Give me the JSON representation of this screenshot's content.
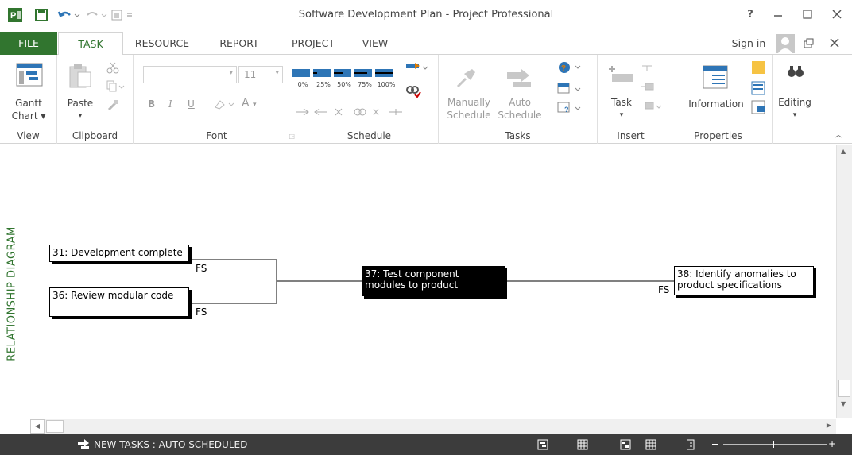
{
  "window": {
    "title": "Software Development Plan - Project Professional",
    "help": "?",
    "sign_in": "Sign in"
  },
  "tabs": [
    "FILE",
    "TASK",
    "RESOURCE",
    "REPORT",
    "PROJECT",
    "VIEW"
  ],
  "ribbon": {
    "view_group": {
      "gantt_line1": "Gantt",
      "gantt_line2": "Chart",
      "label": "View"
    },
    "clipboard_group": {
      "paste": "Paste",
      "label": "Clipboard"
    },
    "font_group": {
      "font_size": "11",
      "bold": "B",
      "italic": "I",
      "underline": "U",
      "font_color": "A",
      "label": "Font"
    },
    "schedule_group": {
      "pct": [
        "0%",
        "25%",
        "50%",
        "75%",
        "100%"
      ],
      "label": "Schedule"
    },
    "tasks_group": {
      "manual_line1": "Manually",
      "manual_line2": "Schedule",
      "auto_line1": "Auto",
      "auto_line2": "Schedule",
      "label": "Tasks"
    },
    "insert_group": {
      "task": "Task",
      "label": "Insert"
    },
    "properties_group": {
      "information": "Information",
      "label": "Properties"
    },
    "editing_group": {
      "editing": "Editing"
    }
  },
  "canvas": {
    "view_label": "RELATIONSHIP DIAGRAM",
    "nodes": [
      {
        "text": "31: Development complete"
      },
      {
        "text": "36: Review modular code"
      },
      {
        "text_line1": "37: Test component",
        "text_line2": "modules to product"
      },
      {
        "text_line1": "38: Identify anomalies to",
        "text_line2": "product specifications"
      }
    ],
    "link_types": [
      "FS",
      "FS",
      "FS"
    ]
  },
  "status": {
    "new_tasks": "NEW TASKS : AUTO SCHEDULED"
  },
  "colors": {
    "accent": "#31752f",
    "status_bar": "#3c3c3c",
    "ribbon_blue": "#2e75b6"
  }
}
